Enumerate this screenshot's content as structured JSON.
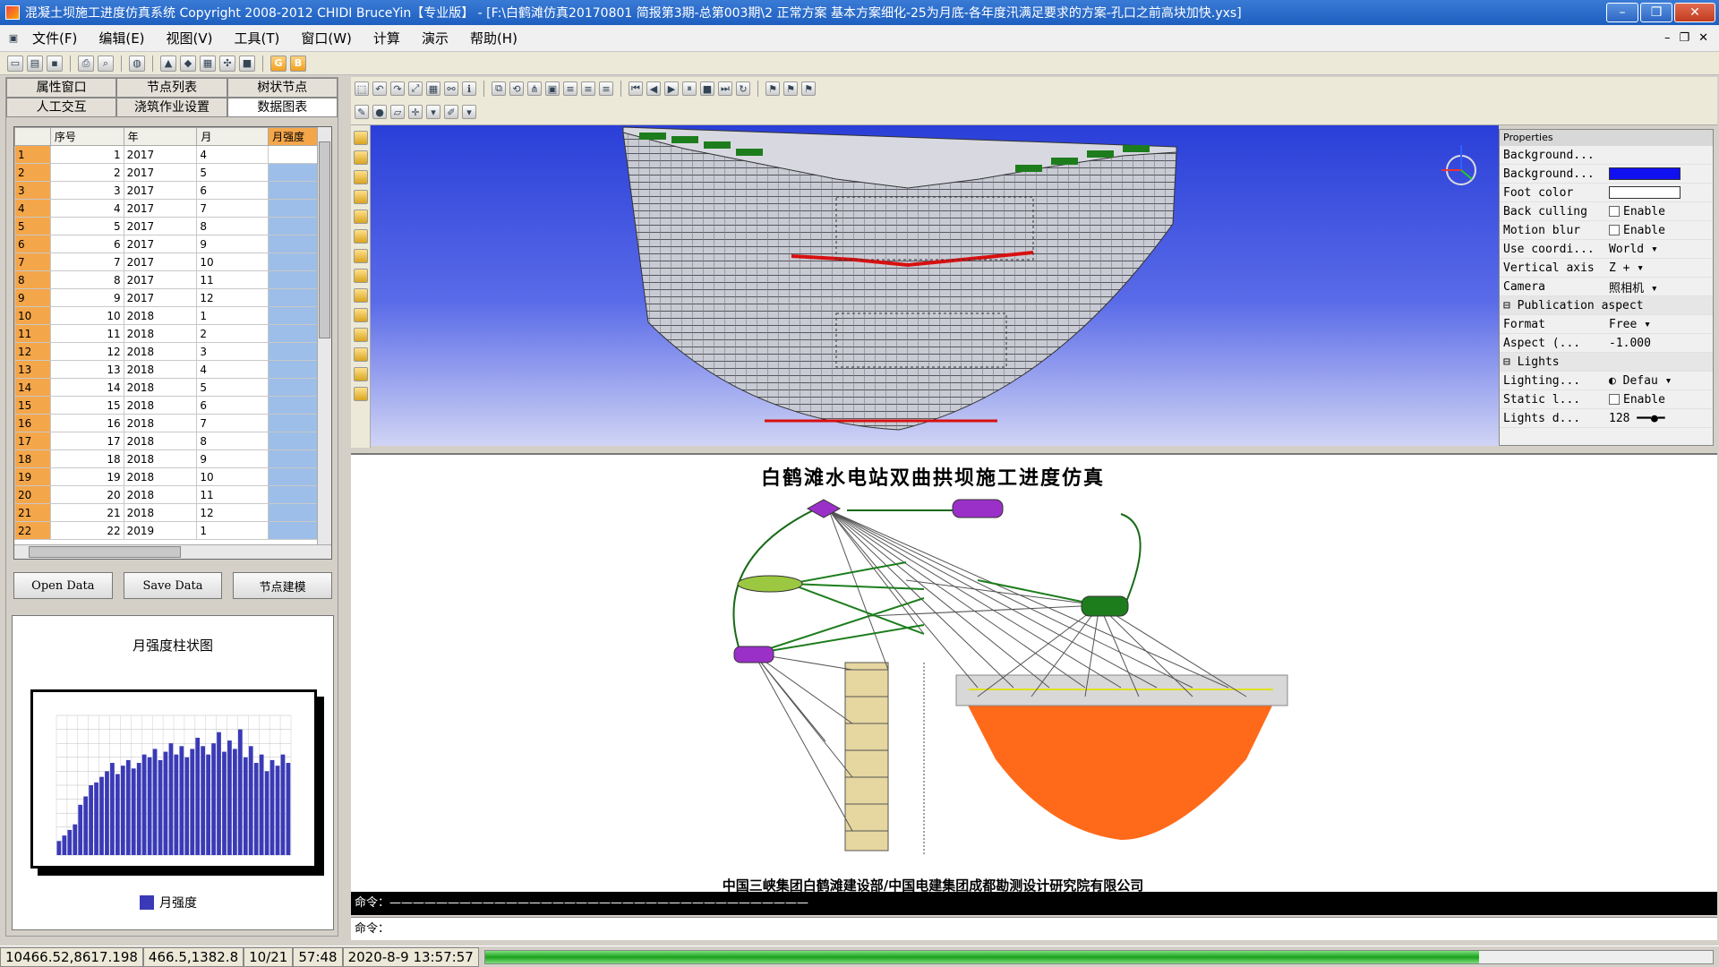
{
  "window": {
    "title": "混凝土坝施工进度仿真系统 Copyright 2008-2012 CHIDI BruceYin【专业版】 - [F:\\白鹤滩仿真20170801 简报第3期-总第003期\\2 正常方案 基本方案细化-25为月底-各年度汛满足要求的方案-孔口之前高块加快.yxs]",
    "minimize": "–",
    "restore": "❐",
    "close": "✕"
  },
  "menu": [
    "文件(F)",
    "编辑(E)",
    "视图(V)",
    "工具(T)",
    "窗口(W)",
    "计算",
    "演示",
    "帮助(H)"
  ],
  "mdi_buttons": [
    "–",
    "❐",
    "✕"
  ],
  "toolbar_letters": [
    "G",
    "B"
  ],
  "left_tabs_row1": [
    "属性窗口",
    "节点列表",
    "树状节点"
  ],
  "left_tabs_row2": [
    "人工交互",
    "浇筑作业设置",
    "数据图表"
  ],
  "grid": {
    "headers": [
      "",
      "序号",
      "年",
      "月",
      "月强度"
    ],
    "rows": [
      [
        "1",
        "1",
        "2017",
        "4"
      ],
      [
        "2",
        "2",
        "2017",
        "5"
      ],
      [
        "3",
        "3",
        "2017",
        "6"
      ],
      [
        "4",
        "4",
        "2017",
        "7"
      ],
      [
        "5",
        "5",
        "2017",
        "8"
      ],
      [
        "6",
        "6",
        "2017",
        "9"
      ],
      [
        "7",
        "7",
        "2017",
        "10"
      ],
      [
        "8",
        "8",
        "2017",
        "11"
      ],
      [
        "9",
        "9",
        "2017",
        "12"
      ],
      [
        "10",
        "10",
        "2018",
        "1"
      ],
      [
        "11",
        "11",
        "2018",
        "2"
      ],
      [
        "12",
        "12",
        "2018",
        "3"
      ],
      [
        "13",
        "13",
        "2018",
        "4"
      ],
      [
        "14",
        "14",
        "2018",
        "5"
      ],
      [
        "15",
        "15",
        "2018",
        "6"
      ],
      [
        "16",
        "16",
        "2018",
        "7"
      ],
      [
        "17",
        "17",
        "2018",
        "8"
      ],
      [
        "18",
        "18",
        "2018",
        "9"
      ],
      [
        "19",
        "19",
        "2018",
        "10"
      ],
      [
        "20",
        "20",
        "2018",
        "11"
      ],
      [
        "21",
        "21",
        "2018",
        "12"
      ],
      [
        "22",
        "22",
        "2019",
        "1"
      ]
    ]
  },
  "buttons": {
    "open": "Open Data",
    "save": "Save Data",
    "node": "节点建模"
  },
  "chart": {
    "title": "月强度柱状图",
    "legend": "月强度",
    "bar_color": "#3a3ab8"
  },
  "chart_data": {
    "type": "bar",
    "title": "月强度柱状图",
    "series": [
      {
        "name": "月强度",
        "values": [
          0.1,
          0.14,
          0.18,
          0.22,
          0.36,
          0.42,
          0.5,
          0.52,
          0.56,
          0.6,
          0.66,
          0.58,
          0.64,
          0.68,
          0.62,
          0.66,
          0.72,
          0.7,
          0.76,
          0.68,
          0.74,
          0.8,
          0.72,
          0.78,
          0.7,
          0.76,
          0.84,
          0.78,
          0.72,
          0.8,
          0.88,
          0.74,
          0.82,
          0.76,
          0.9,
          0.7,
          0.78,
          0.66,
          0.72,
          0.6,
          0.68,
          0.64,
          0.72,
          0.66
        ]
      }
    ],
    "ylim": [
      0,
      1
    ]
  },
  "properties": {
    "header": "Properties",
    "rows": [
      {
        "k": "Background...",
        "v": ""
      },
      {
        "k": "Background...",
        "v": "",
        "swatch": "#1010f0"
      },
      {
        "k": "Foot color",
        "v": "",
        "swatch": "#ffffff"
      },
      {
        "k": "Back culling",
        "v": "Enable",
        "check": true
      },
      {
        "k": "Motion blur",
        "v": "Enable",
        "check": true
      },
      {
        "k": "Use coordi...",
        "v": "World ▾"
      },
      {
        "k": "Vertical axis",
        "v": "Z + ▾"
      },
      {
        "k": "Camera",
        "v": "照相机 ▾"
      },
      {
        "k": "⊟ Publication aspect",
        "v": "",
        "group": true
      },
      {
        "k": "  Format",
        "v": "Free ▾"
      },
      {
        "k": "  Aspect (...",
        "v": "-1.000"
      },
      {
        "k": "⊟ Lights",
        "v": "",
        "group": true
      },
      {
        "k": "  Lighting...",
        "v": "◐ Defau ▾"
      },
      {
        "k": "  Static l...",
        "v": "Enable",
        "check": true
      },
      {
        "k": "  Lights d...",
        "v": "128 ━━●━"
      }
    ]
  },
  "diagram": {
    "title": "白鹤滩水电站双曲拱坝施工进度仿真",
    "footer": "中国三峡集团白鹤滩建设部/中国电建集团成都勘测设计研究院有限公司",
    "reservoir_color": "#ff6a1a"
  },
  "command": {
    "line1": "命令：————————————————————————————————————",
    "line2": "命令："
  },
  "status": {
    "coord1": "10466.52,8617.198",
    "coord2": "466.5,1382.8",
    "page": "10/21",
    "time": "57:48",
    "datetime": "2020-8-9 13:57:57",
    "progress": 0.81
  }
}
